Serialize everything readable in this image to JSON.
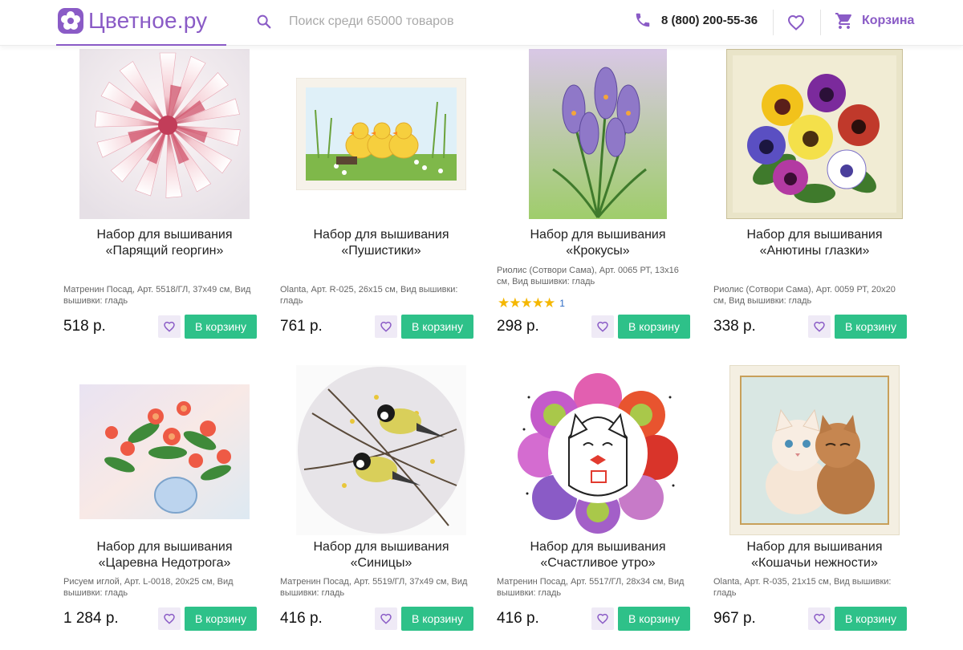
{
  "header": {
    "logo_text": "Цветное.ру",
    "search_placeholder": "Поиск среди 65000 товаров",
    "phone": "8 (800) 200-55-36",
    "cart_label": "Корзина"
  },
  "colors": {
    "brand": "#8a5bc6",
    "cart_button": "#2ec189",
    "fav_button_bg": "#efeaf6",
    "star": "#f5b700"
  },
  "products": [
    {
      "title_line1": "Набор для вышивания",
      "title_line2": "«Парящий георгин»",
      "meta": "Матренин Посад, Арт. 5518/ГЛ, 37х49 см, Вид вышивки: гладь",
      "price": "518 р.",
      "cart_label": "В корзину"
    },
    {
      "title_line1": "Набор для вышивания",
      "title_line2": "«Пушистики»",
      "meta": "Olanta, Арт. R-025, 26х15 см, Вид вышивки: гладь",
      "price": "761 р.",
      "cart_label": "В корзину"
    },
    {
      "title_line1": "Набор для вышивания",
      "title_line2": "«Крокусы»",
      "meta": "Риолис (Сотвори Сама), Арт. 0065 РТ, 13х16 см, Вид вышивки: гладь",
      "price": "298 р.",
      "cart_label": "В корзину",
      "rating_stars": 5,
      "rating_count": "1"
    },
    {
      "title_line1": "Набор для вышивания",
      "title_line2": "«Анютины глазки»",
      "meta": "Риолис (Сотвори Сама), Арт. 0059 РТ, 20х20 см, Вид вышивки: гладь",
      "price": "338 р.",
      "cart_label": "В корзину"
    },
    {
      "title_line1": "Набор для вышивания",
      "title_line2": "«Царевна Недотрога»",
      "meta": "Рисуем иглой, Арт. L-0018, 20х25 см, Вид вышивки: гладь",
      "price": "1 284 р.",
      "cart_label": "В корзину"
    },
    {
      "title_line1": "Набор для вышивания",
      "title_line2": "«Синицы»",
      "meta": "Матренин Посад, Арт. 5519/ГЛ, 37х49 см, Вид вышивки: гладь",
      "price": "416 р.",
      "cart_label": "В корзину"
    },
    {
      "title_line1": "Набор для вышивания",
      "title_line2": "«Счастливое утро»",
      "meta": "Матренин Посад, Арт. 5517/ГЛ, 28х34 см, Вид вышивки: гладь",
      "price": "416 р.",
      "cart_label": "В корзину"
    },
    {
      "title_line1": "Набор для вышивания",
      "title_line2": "«Кошачьи нежности»",
      "meta": "Olanta, Арт. R-035, 21х15 см, Вид вышивки: гладь",
      "price": "967 р.",
      "cart_label": "В корзину"
    }
  ]
}
